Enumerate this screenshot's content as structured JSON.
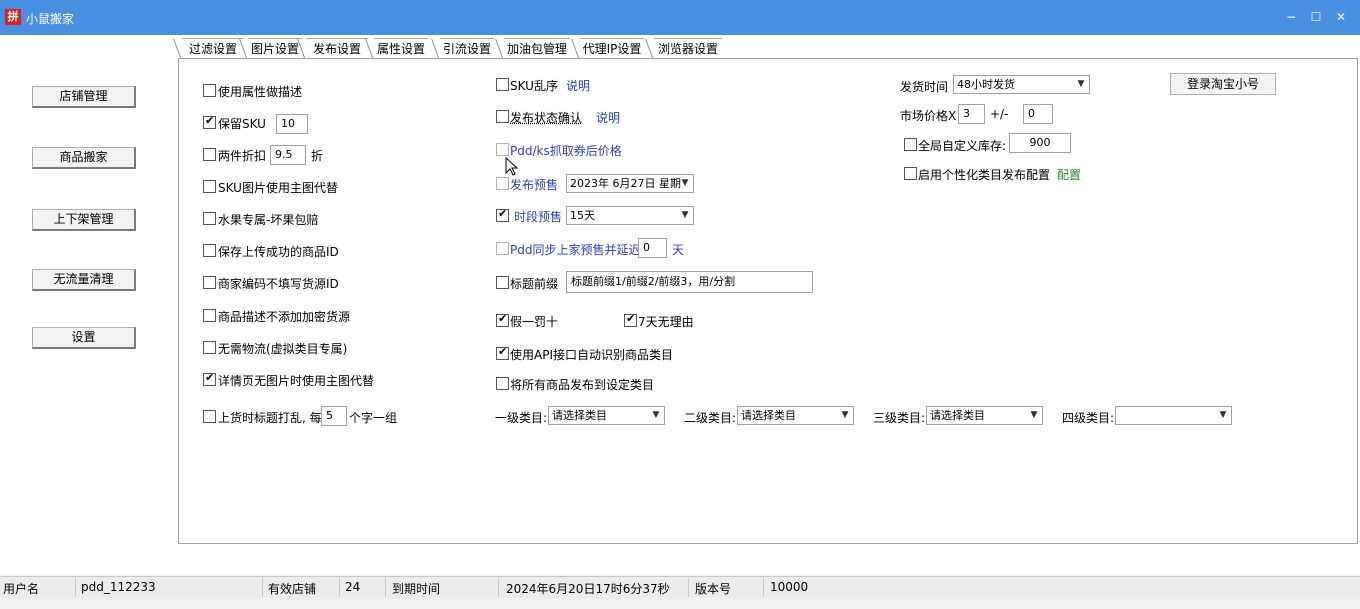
{
  "window": {
    "title": "小鼠搬家",
    "icon_text": "拼",
    "minimize": "−",
    "maximize": "☐",
    "close": "✕"
  },
  "sidebar": {
    "items": [
      "店铺管理",
      "商品搬家",
      "上下架管理",
      "无流量清理",
      "设置"
    ]
  },
  "tabs": [
    "过滤设置",
    "图片设置",
    "发布设置",
    "属性设置",
    "引流设置",
    "加油包管理",
    "代理IP设置",
    "浏览器设置"
  ],
  "active_tab": "发布设置",
  "left_col": {
    "attr_desc": {
      "label": "使用属性做描述",
      "checked": false
    },
    "keep_sku": {
      "label": "保留SKU",
      "checked": true,
      "value": "10"
    },
    "two_piece": {
      "label": "两件折扣",
      "checked": false,
      "value": "9.5",
      "suffix": "折"
    },
    "sku_img": {
      "label": "SKU图片使用主图代替",
      "checked": false
    },
    "fruit": {
      "label": "水果专属-坏果包赔",
      "checked": false
    },
    "save_id": {
      "label": "保存上传成功的商品ID",
      "checked": false
    },
    "merchant_code": {
      "label": "商家编码不填写货源ID",
      "checked": false
    },
    "no_encrypt": {
      "label": "商品描述不添加加密货源",
      "checked": false
    },
    "no_logistics": {
      "label": "无需物流(虚拟类目专属)",
      "checked": false
    },
    "detail_main": {
      "label": "详情页无图片时使用主图代替",
      "checked": true
    },
    "shuffle_title": {
      "label": "上货时标题打乱, 每",
      "checked": false,
      "value": "5",
      "suffix": "个字一组"
    }
  },
  "mid_col": {
    "sku_shuffle": {
      "label": "SKU乱序",
      "checked": false,
      "link": "说明"
    },
    "confirm_status": {
      "label": "发布状态确认",
      "checked": false,
      "link": "说明"
    },
    "pdd_coupon": {
      "label": "Pdd/ks抓取券后价格",
      "checked": false
    },
    "presale": {
      "label": "发布预售",
      "checked": false,
      "date": "2023年 6月27日 星期"
    },
    "period_presale": {
      "label": "时段预售",
      "checked": true,
      "value": "15天"
    },
    "pdd_sync": {
      "label": "Pdd同步上家预售并延迟",
      "checked": false,
      "value": "0",
      "suffix": "天"
    },
    "title_prefix": {
      "label": "标题前缀",
      "checked": false,
      "value": "标题前缀1/前缀2/前缀3，用/分割"
    },
    "fake_ten": {
      "label": "假一罚十",
      "checked": true
    },
    "seven_days": {
      "label": "7天无理由",
      "checked": true
    },
    "api_category": {
      "label": "使用API接口自动识别商品类目",
      "checked": true
    },
    "set_category": {
      "label": "将所有商品发布到设定类目",
      "checked": false
    }
  },
  "categories": [
    {
      "label": "一级类目:",
      "value": "请选择类目"
    },
    {
      "label": "二级类目:",
      "value": "请选择类目"
    },
    {
      "label": "三级类目:",
      "value": "请选择类目"
    },
    {
      "label": "四级类目:",
      "value": ""
    }
  ],
  "right_col": {
    "ship_time_label": "发货时间",
    "ship_time_value": "48小时发货",
    "market_price_label": "市场价格X",
    "market_price_value": "3",
    "plus_minus": "+/-",
    "plus_minus_value": "0",
    "global_stock": {
      "label": "全局自定义库存:",
      "checked": false,
      "value": "900"
    },
    "custom_category": {
      "label": "启用个性化类目发布配置",
      "checked": false,
      "link": "配置"
    },
    "login_button": "登录淘宝小号"
  },
  "status": {
    "user_label": "用户名",
    "user_value": "pdd_112233",
    "shops_label": "有效店铺",
    "shops_value": "24",
    "expire_label": "到期时间",
    "expire_value": "2024年6月20日17时6分37秒",
    "version_label": "版本号",
    "version_value": "10000"
  }
}
